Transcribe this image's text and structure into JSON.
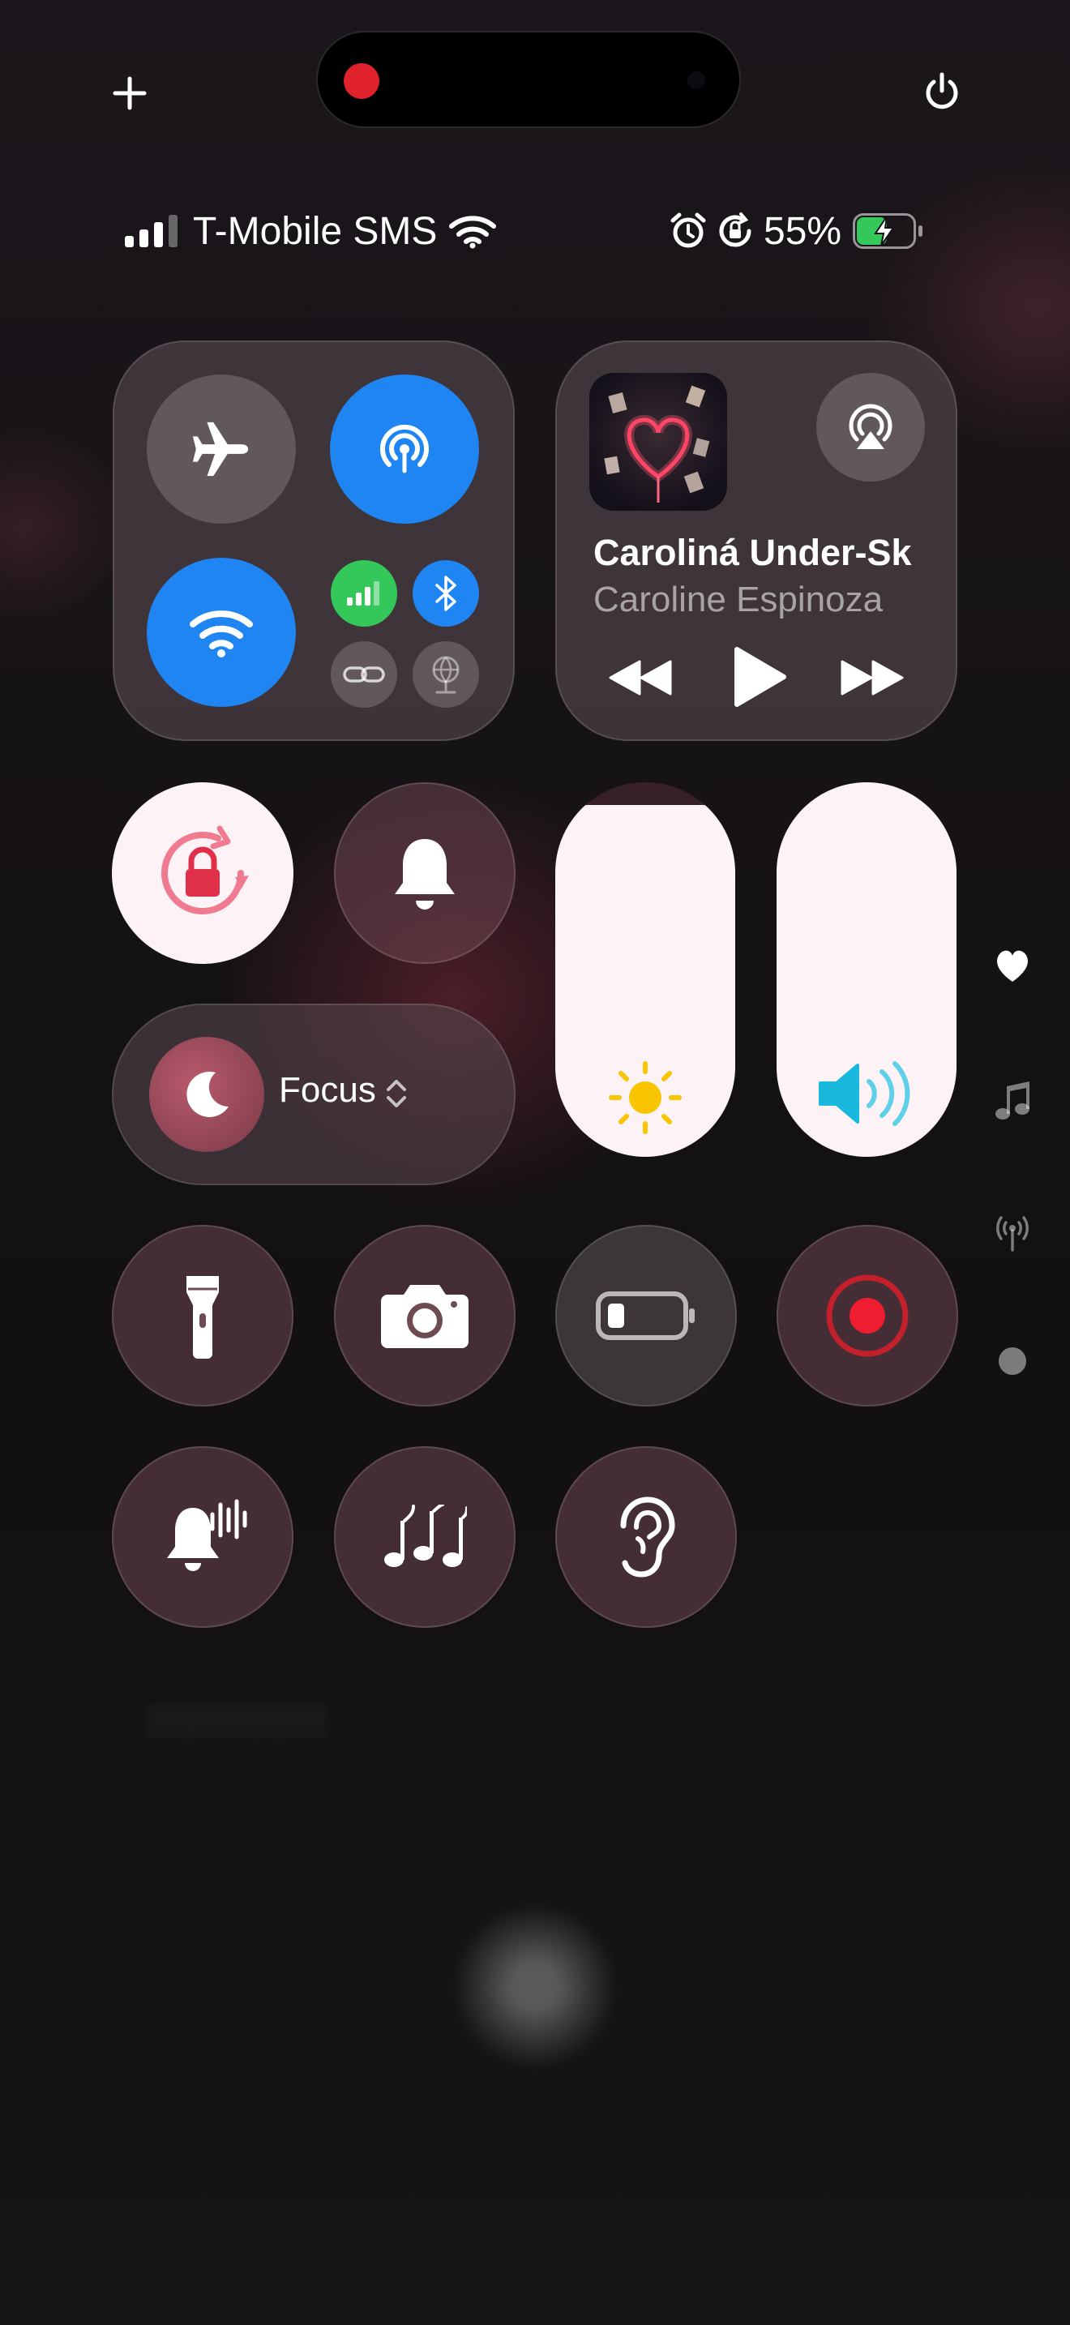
{
  "status_bar": {
    "carrier": "T-Mobile SMS",
    "battery_percent": "55%",
    "battery_level": 0.55,
    "icons": [
      "signal-bars-icon",
      "wifi-icon",
      "alarm-icon",
      "rotation-lock-icon",
      "battery-charging-icon"
    ]
  },
  "top_controls": {
    "add_icon": "plus-icon",
    "power_icon": "power-icon"
  },
  "connectivity": {
    "airplane": "airplane-icon",
    "airdrop": "airdrop-icon",
    "wifi": "wifi-icon",
    "cellular": "cellular-icon",
    "bluetooth": "bluetooth-icon",
    "hotspot": "link-icon",
    "vpn": "vpn-icon",
    "colors": {
      "active_blue": "#1e85f2",
      "cellular_green": "#34c759"
    }
  },
  "now_playing": {
    "title": "Caroliná Under-Sk",
    "artist": "Caroline Espinoza",
    "icons": [
      "airplay-icon",
      "rewind-icon",
      "play-icon",
      "fast-forward-icon"
    ]
  },
  "controls": {
    "orientation_lock": "orientation-lock-icon",
    "silent_mode": "bell-icon",
    "focus_label": "Focus",
    "brightness_level": 0.94,
    "volume_level": 1.0,
    "tiles": [
      "flashlight-icon",
      "camera-icon",
      "low-power-icon",
      "screen-record-icon",
      "sound-recognition-icon",
      "music-recognition-icon",
      "hearing-icon"
    ]
  },
  "side_pages": [
    "heart-icon",
    "music-note-icon",
    "antenna-icon",
    "dot-icon"
  ]
}
